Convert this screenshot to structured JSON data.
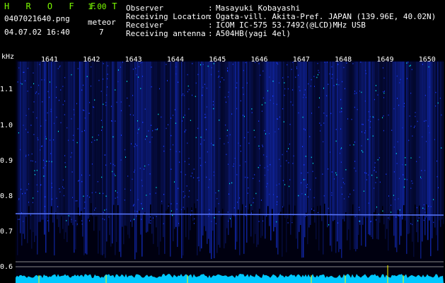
{
  "header": {
    "app_title": "H R O F F T",
    "version": "1.00",
    "filename": "0407021640.png",
    "meteor_label": "meteor",
    "meteor_count": "7",
    "datetime": "04.07.02 16:40"
  },
  "info": [
    {
      "label": "Observer",
      "value": "Masayuki Kobayashi"
    },
    {
      "label": "Receiving Location",
      "value": "Ogata-vill. Akita-Pref. JAPAN (139.96E, 40.02N)"
    },
    {
      "label": "Receiver",
      "value": "ICOM IC-575 53.7492(@LCD)MHz USB"
    },
    {
      "label": "Receiving antenna",
      "value": "A504HB(yagi 4el)"
    }
  ],
  "spectrogram": {
    "y_unit": "kHz",
    "y_ticks": [
      "1.1",
      "1.0",
      "0.9",
      "0.8",
      "0.7",
      "0.6"
    ],
    "x_ticks": [
      "1641",
      "1642",
      "1643",
      "1644",
      "1645",
      "1646",
      "1647",
      "1648",
      "1649",
      "1650"
    ],
    "colors": {
      "background": "#000010",
      "signal": "#1a3cff",
      "bright": "#00ffff",
      "line": "#5a78ff"
    }
  }
}
